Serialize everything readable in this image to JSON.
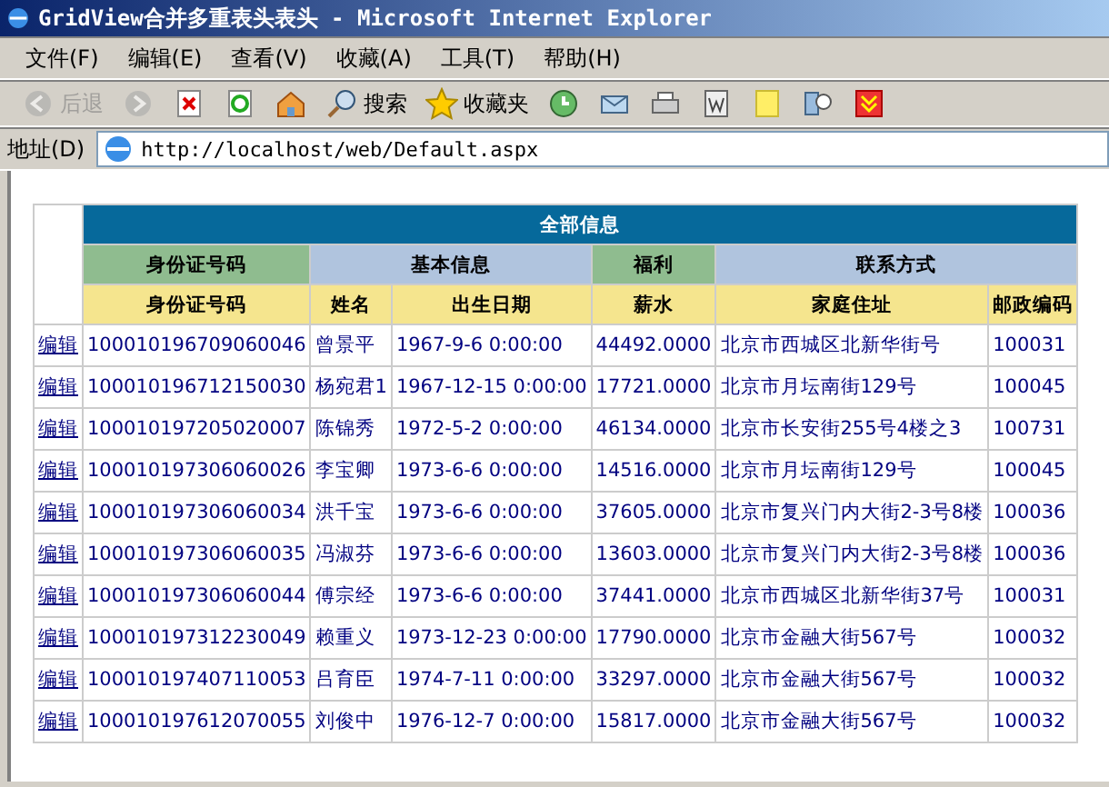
{
  "window": {
    "title": "GridView合并多重表头表头 - Microsoft Internet Explorer"
  },
  "menu": [
    "文件(F)",
    "编辑(E)",
    "查看(V)",
    "收藏(A)",
    "工具(T)",
    "帮助(H)"
  ],
  "toolbar": [
    {
      "kind": "back",
      "label": "后退",
      "disabled": true
    },
    {
      "kind": "forward",
      "disabled": true
    },
    {
      "kind": "stop",
      "disabled": false
    },
    {
      "kind": "refresh",
      "disabled": false
    },
    {
      "kind": "home",
      "disabled": false
    },
    {
      "kind": "search",
      "label": "搜索",
      "disabled": false
    },
    {
      "kind": "favorites",
      "label": "收藏夹",
      "disabled": false
    },
    {
      "kind": "history",
      "disabled": false
    },
    {
      "kind": "mail",
      "disabled": false
    },
    {
      "kind": "print",
      "disabled": false
    },
    {
      "kind": "edit",
      "disabled": false
    },
    {
      "kind": "note",
      "disabled": false
    },
    {
      "kind": "research",
      "disabled": false
    },
    {
      "kind": "download",
      "disabled": false
    }
  ],
  "address": {
    "label": "地址(D)",
    "value": "http://localhost/web/Default.aspx"
  },
  "table": {
    "title": "全部信息",
    "groups": [
      {
        "label": "身份证号码",
        "color": "#8fbc8f",
        "columns": [
          "身份证号码"
        ]
      },
      {
        "label": "基本信息",
        "color": "#b0c4de",
        "columns": [
          "姓名",
          "出生日期"
        ]
      },
      {
        "label": "福利",
        "color": "#8fbc8f",
        "columns": [
          "薪水"
        ]
      },
      {
        "label": "联系方式",
        "color": "#b0c4de",
        "columns": [
          "家庭住址",
          "邮政编码"
        ]
      }
    ],
    "rows": [
      {
        "action": "编辑",
        "cells": [
          "100010196709060046",
          "曾景平",
          "1967-9-6 0:00:00",
          "44492.0000",
          "北京市西城区北新华街号",
          "100031"
        ]
      },
      {
        "action": "编辑",
        "cells": [
          "100010196712150030",
          "杨宛君1",
          "1967-12-15 0:00:00",
          "17721.0000",
          "北京市月坛南街129号",
          "100045"
        ]
      },
      {
        "action": "编辑",
        "cells": [
          "100010197205020007",
          "陈锦秀",
          "1972-5-2 0:00:00",
          "46134.0000",
          "北京市长安街255号4楼之3",
          "100731"
        ]
      },
      {
        "action": "编辑",
        "cells": [
          "100010197306060026",
          "李宝卿",
          "1973-6-6 0:00:00",
          "14516.0000",
          "北京市月坛南街129号",
          "100045"
        ]
      },
      {
        "action": "编辑",
        "cells": [
          "100010197306060034",
          "洪千宝",
          "1973-6-6 0:00:00",
          "37605.0000",
          "北京市复兴门内大街2-3号8楼",
          "100036"
        ]
      },
      {
        "action": "编辑",
        "cells": [
          "100010197306060035",
          "冯淑芬",
          "1973-6-6 0:00:00",
          "13603.0000",
          "北京市复兴门内大街2-3号8楼",
          "100036"
        ]
      },
      {
        "action": "编辑",
        "cells": [
          "100010197306060044",
          "傅宗经",
          "1973-6-6 0:00:00",
          "37441.0000",
          "北京市西城区北新华街37号",
          "100031"
        ]
      },
      {
        "action": "编辑",
        "cells": [
          "100010197312230049",
          "赖重义",
          "1973-12-23 0:00:00",
          "17790.0000",
          "北京市金融大街567号",
          "100032"
        ]
      },
      {
        "action": "编辑",
        "cells": [
          "100010197407110053",
          "吕育臣",
          "1974-7-11 0:00:00",
          "33297.0000",
          "北京市金融大街567号",
          "100032"
        ]
      },
      {
        "action": "编辑",
        "cells": [
          "100010197612070055",
          "刘俊中",
          "1976-12-7 0:00:00",
          "15817.0000",
          "北京市金融大街567号",
          "100032"
        ]
      }
    ]
  }
}
